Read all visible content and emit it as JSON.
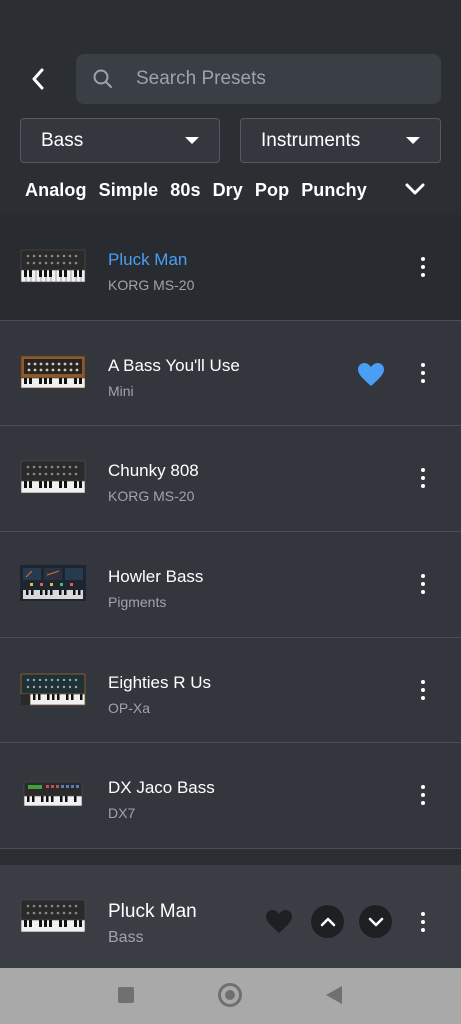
{
  "search": {
    "placeholder": "Search Presets"
  },
  "filters": {
    "category": "Bass",
    "type": "Instruments"
  },
  "tags": [
    "Analog",
    "Simple",
    "80s",
    "Dry",
    "Pop",
    "Punchy"
  ],
  "presets": [
    {
      "title": "Pluck Man",
      "subtitle": "KORG MS-20",
      "selected": true,
      "favorite": false,
      "thumb": "ms20"
    },
    {
      "title": "A Bass You'll Use",
      "subtitle": "Mini",
      "selected": false,
      "favorite": true,
      "thumb": "mini"
    },
    {
      "title": "Chunky 808",
      "subtitle": "KORG MS-20",
      "selected": false,
      "favorite": false,
      "thumb": "ms20"
    },
    {
      "title": "Howler Bass",
      "subtitle": "Pigments",
      "selected": false,
      "favorite": false,
      "thumb": "pigments"
    },
    {
      "title": "Eighties R Us",
      "subtitle": "OP-Xa",
      "selected": false,
      "favorite": false,
      "thumb": "opxa"
    },
    {
      "title": "DX Jaco Bass",
      "subtitle": "DX7",
      "selected": false,
      "favorite": false,
      "thumb": "dx7"
    }
  ],
  "player": {
    "title": "Pluck Man",
    "subtitle": "Bass"
  },
  "colors": {
    "accent": "#4a9ff5",
    "background": "#2b2e33",
    "row": "#33363c",
    "selected_row": "#282b30"
  }
}
